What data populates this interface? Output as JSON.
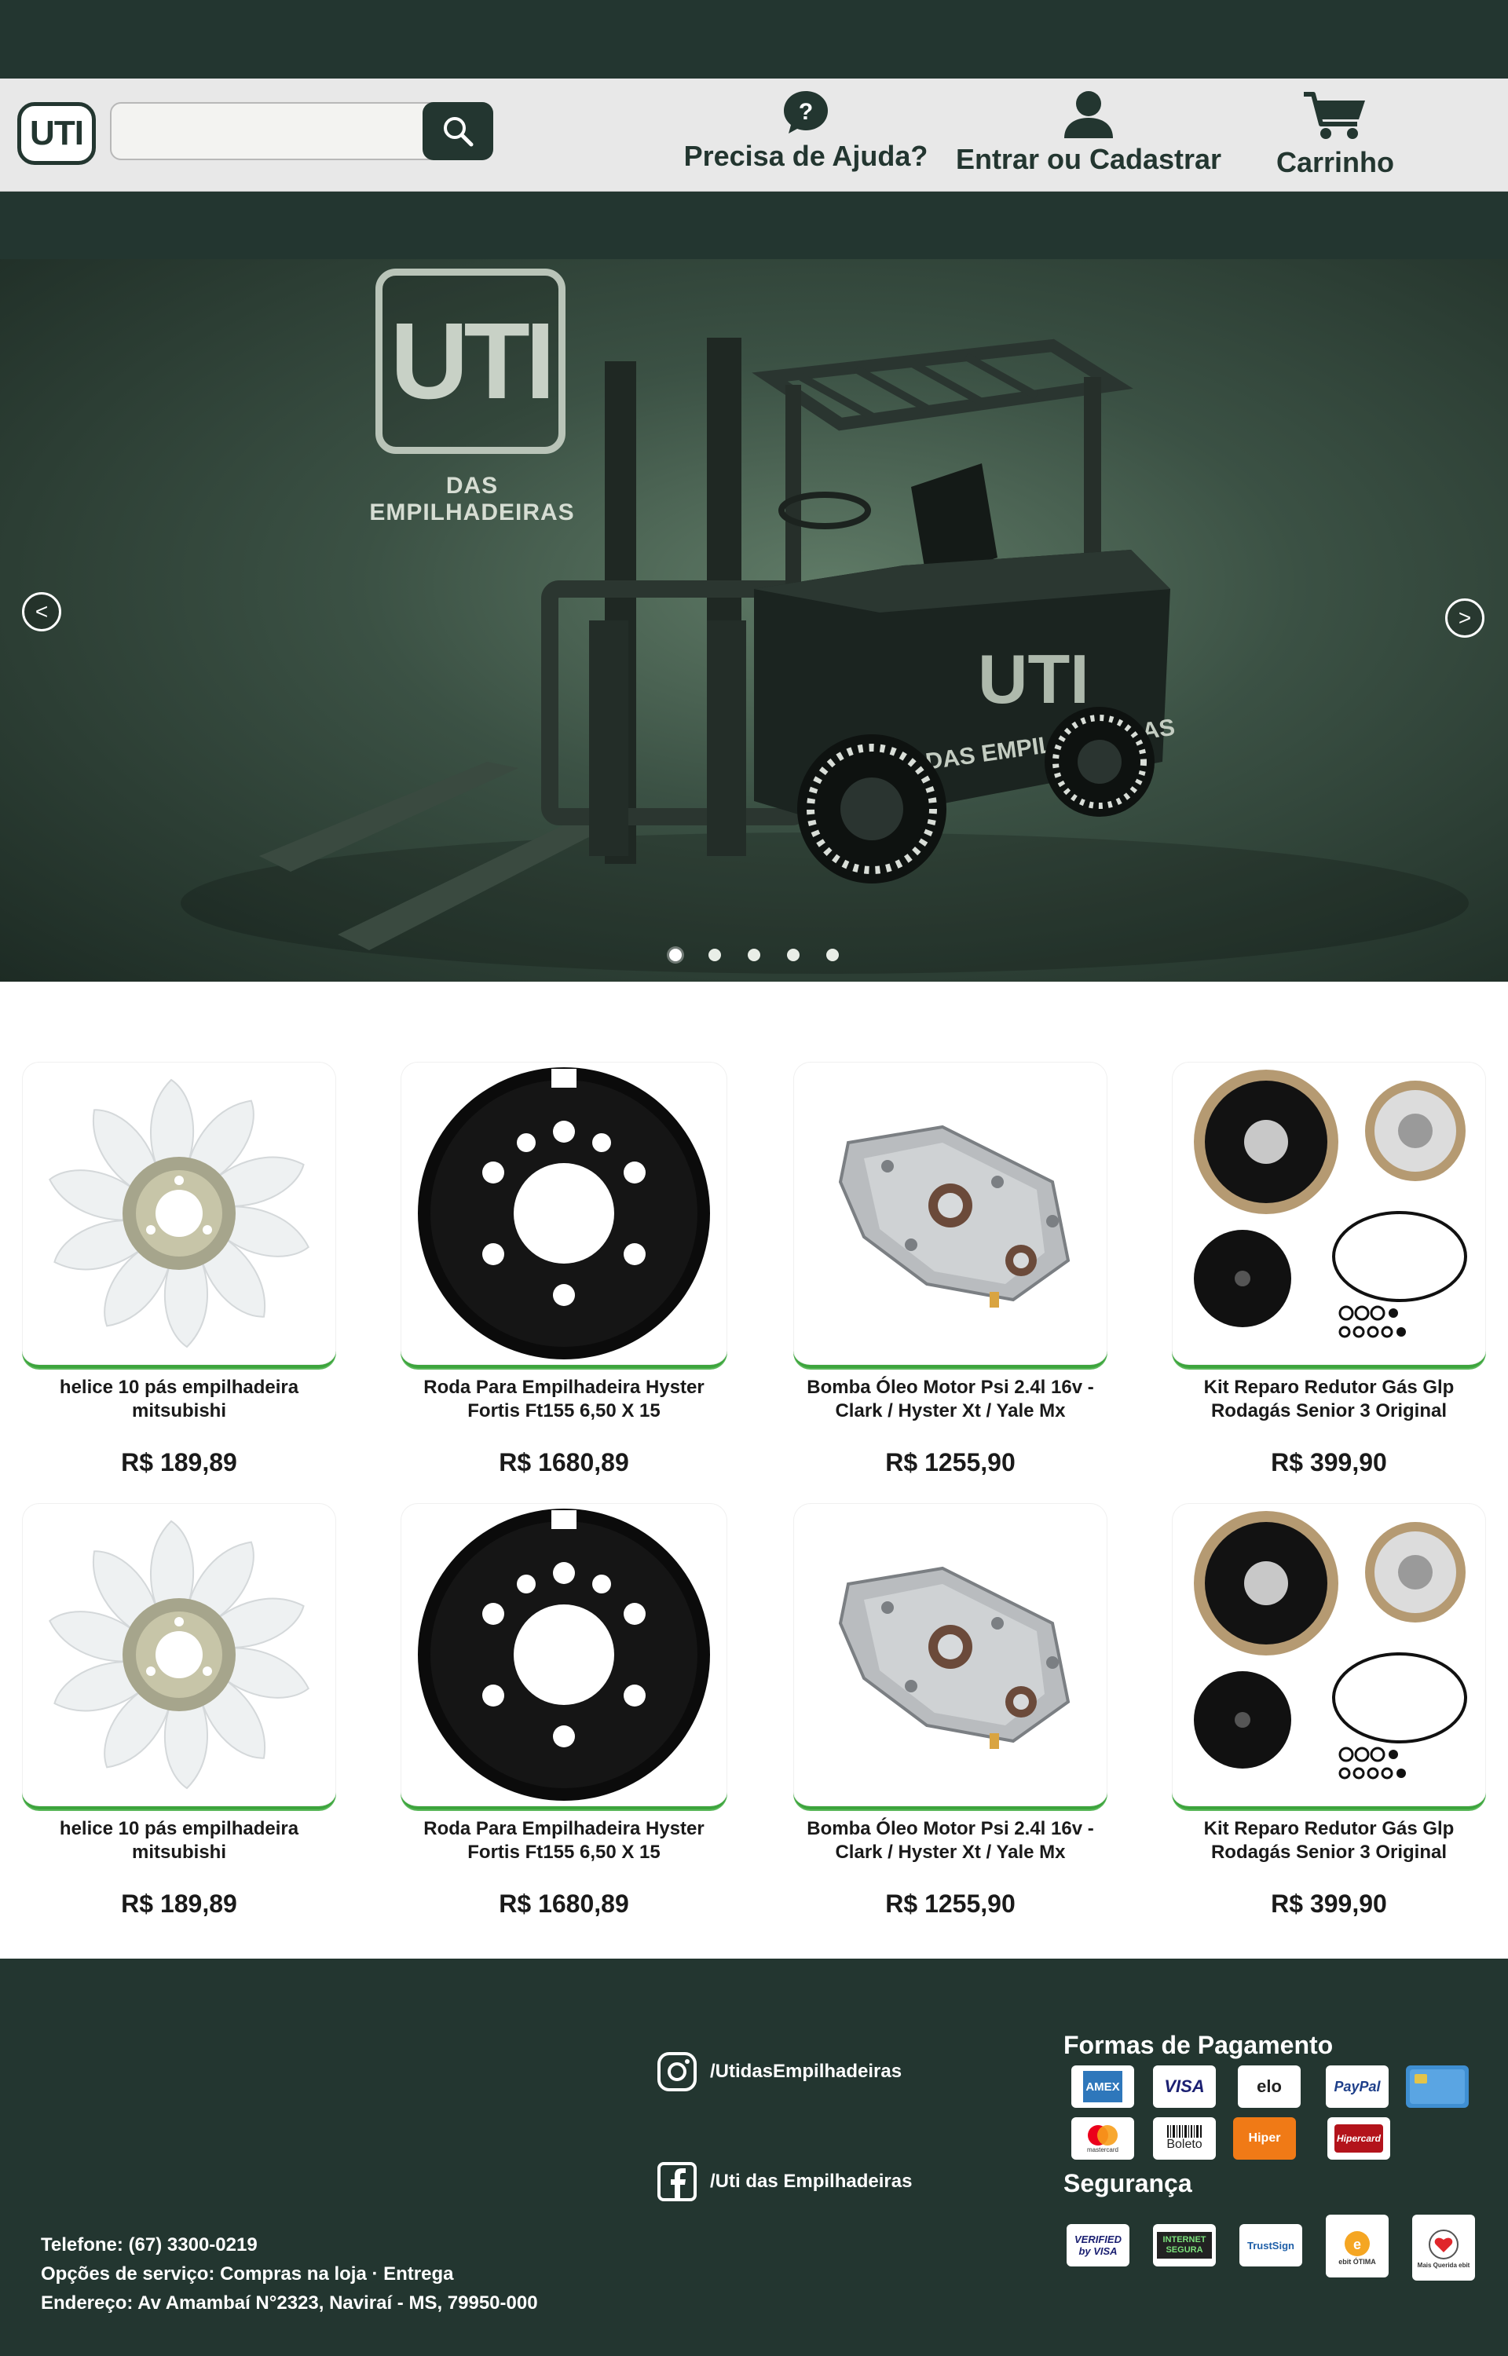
{
  "header": {
    "logo_text": "UTI",
    "search": {
      "value": "",
      "placeholder": ""
    },
    "help_label": "Precisa de Ajuda?",
    "account_label": "Entrar ou Cadastrar",
    "cart_label": "Carrinho",
    "colors": {
      "dark_green": "#233630",
      "header_bg": "#e8e8e8"
    }
  },
  "hero": {
    "logo_text": "UTI",
    "subtitle": "DAS EMPILHADEIRAS",
    "truck_logo": "UTI",
    "truck_text": "DAS EMPILHADEIRAS",
    "prev_arrow": "<",
    "next_arrow": ">",
    "slide_count": 5,
    "active_slide": 1
  },
  "products": [
    {
      "name": "helice 10 pás empilhadeira mitsubishi",
      "price": "R$ 189,89",
      "image": "fan-icon"
    },
    {
      "name": "Roda Para Empilhadeira Hyster Fortis Ft155 6,50 X 15",
      "price": "R$ 1680,89",
      "image": "wheel-icon"
    },
    {
      "name": "Bomba Óleo Motor Psi 2.4l 16v - Clark / Hyster Xt / Yale Mx",
      "price": "R$ 1255,90",
      "image": "oil-pump-icon"
    },
    {
      "name": "Kit Reparo Redutor Gás Glp Rodagás Senior 3 Original",
      "price": "R$ 399,90",
      "image": "repair-kit-icon"
    },
    {
      "name": "helice 10 pás empilhadeira mitsubishi",
      "price": "R$ 189,89",
      "image": "fan-icon"
    },
    {
      "name": "Roda Para Empilhadeira Hyster Fortis Ft155 6,50 X 15",
      "price": "R$ 1680,89",
      "image": "wheel-icon"
    },
    {
      "name": "Bomba Óleo Motor Psi 2.4l 16v - Clark / Hyster Xt / Yale Mx",
      "price": "R$ 1255,90",
      "image": "oil-pump-icon"
    },
    {
      "name": "Kit Reparo Redutor Gás Glp Rodagás Senior 3 Original",
      "price": "R$ 399,90",
      "image": "repair-kit-icon"
    }
  ],
  "footer": {
    "instagram": "/UtidasEmpilhadeiras",
    "facebook": "/Uti das Empilhadeiras",
    "payment_title": "Formas de Pagamento",
    "payment_methods": [
      "AMEX",
      "VISA",
      "elo",
      "PayPal",
      "card",
      "mastercard",
      "Boleto",
      "Hiper",
      "Hipercard"
    ],
    "security_title": "Segurança",
    "security_badges": [
      "VERIFIED by VISA",
      "INTERNET SEGURA",
      "TrustSign",
      "ebit ÓTIMA",
      "Mais Querida ebit"
    ],
    "phone": "Telefone: (67) 3300-0219",
    "services": "Opções de serviço: Compras na loja · Entrega",
    "address": "Endereço: Av Amambaí N°2323, Naviraí - MS, 79950-000"
  }
}
